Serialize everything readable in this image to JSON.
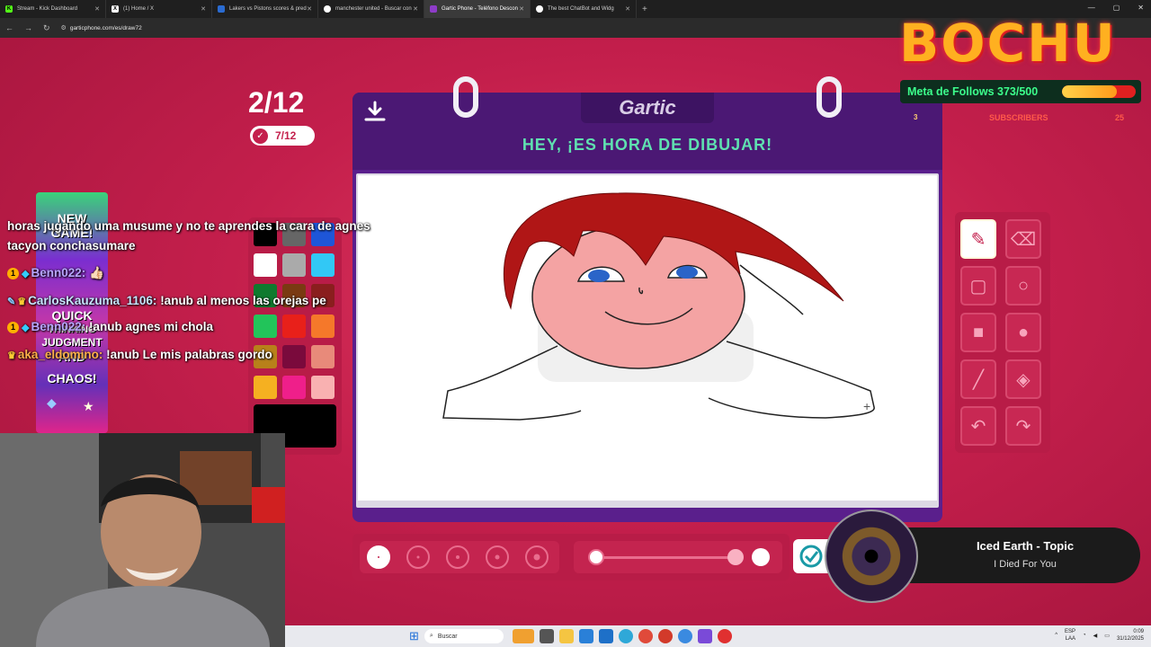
{
  "browser": {
    "tabs": [
      {
        "label": "Stream - Kick Dashboard",
        "favicon": "K",
        "color": "#53fc18"
      },
      {
        "label": "(1) Home / X",
        "favicon": "X",
        "color": "#ffffff"
      },
      {
        "label": "Lakers vs Pistons scores & pred",
        "favicon": "",
        "color": "#2a6bd1"
      },
      {
        "label": "manchester united - Buscar con",
        "favicon": "",
        "color": "#ffffff"
      },
      {
        "label": "Gartic Phone - Teléfono Descon",
        "favicon": "",
        "color": "#8e3cc8"
      },
      {
        "label": "The best ChatBot and Widg",
        "favicon": "",
        "color": "#ffffff"
      }
    ],
    "active_tab": 4,
    "url": "garticphone.com/es/draw72"
  },
  "game": {
    "round": "2/12",
    "players_done": "7/12",
    "logo": "Gartic",
    "title": "HEY, ¡ES HORA DE DIBUJAR!",
    "palette": [
      "#000000",
      "#666666",
      "#1e56d8",
      "#ffffff",
      "#aaaaaa",
      "#32c8f5",
      "#0f7a2e",
      "#7a3a12",
      "#8a1e1e",
      "#22c45a",
      "#e8201a",
      "#f5782a",
      "#b8801a",
      "#7a0a3c",
      "#e88a7a",
      "#f5b021",
      "#ef1f8a",
      "#f9b1b1"
    ],
    "current_color": "#000000",
    "tools": [
      "pencil-icon",
      "eraser-icon",
      "rectangle-outline-icon",
      "circle-outline-icon",
      "rectangle-fill-icon",
      "circle-fill-icon",
      "line-icon",
      "bucket-icon",
      "undo-icon",
      "redo-icon"
    ],
    "brush_sizes": 5,
    "selected_brush": 0,
    "opacity_level": 1.0
  },
  "overlay": {
    "brand": "BOCHU",
    "follows_label": "Meta de Follows 373/500",
    "follows_progress": 0.746,
    "subs_left": "3",
    "subs_label": "SUBSCRIBERS",
    "subs_count": "25",
    "new_game_lines": [
      "NEW",
      "GAME!",
      "QUICK",
      "THINKING",
      "JUDGMENT",
      "AND",
      "CHAOS!"
    ],
    "chat": [
      {
        "user": "",
        "text": "horas jugando uma musume y no te aprendes la cara de agnes"
      },
      {
        "user": "",
        "text": "tacyon conchasumare"
      },
      {
        "user": "Benn022:",
        "text": "👍🏻",
        "badge": "1"
      },
      {
        "user": "CarlosKauzuma_1106:",
        "text": "!anub al menos las orejas pe",
        "badge": "✓"
      },
      {
        "user": "Benn022:",
        "text": "!anub agnes mi chola",
        "badge": "1"
      },
      {
        "user": "aka_eldomino:",
        "text": "!anub Le mis palabras gordo",
        "badge": "♛"
      }
    ],
    "music_title": "Iced Earth - Topic",
    "music_sub": "I Died For You"
  },
  "taskbar": {
    "search_placeholder": "Buscar",
    "lang_top": "ESP",
    "lang_bottom": "LAA",
    "time": "0:09",
    "date": "31/12/2025"
  }
}
